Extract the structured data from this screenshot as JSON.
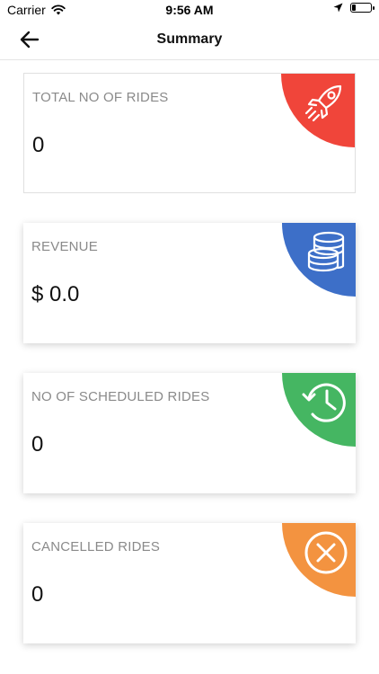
{
  "status_bar": {
    "carrier": "Carrier",
    "time": "9:56 AM",
    "icons": [
      "wifi-icon",
      "location-arrow-icon",
      "battery-icon"
    ],
    "battery_level": 0.2
  },
  "nav": {
    "back_icon": "arrow-left-icon",
    "title": "Summary"
  },
  "cards": [
    {
      "label": "TOTAL NO OF RIDES",
      "value": "0",
      "color": "#f0453a",
      "icon": "rocket-icon"
    },
    {
      "label": "REVENUE",
      "value": "$ 0.0",
      "color": "#3d6fc8",
      "icon": "coins-icon"
    },
    {
      "label": "NO OF SCHEDULED RIDES",
      "value": "0",
      "color": "#45b662",
      "icon": "clock-history-icon"
    },
    {
      "label": "CANCELLED RIDES",
      "value": "0",
      "color": "#f39340",
      "icon": "cancel-circle-icon"
    }
  ]
}
